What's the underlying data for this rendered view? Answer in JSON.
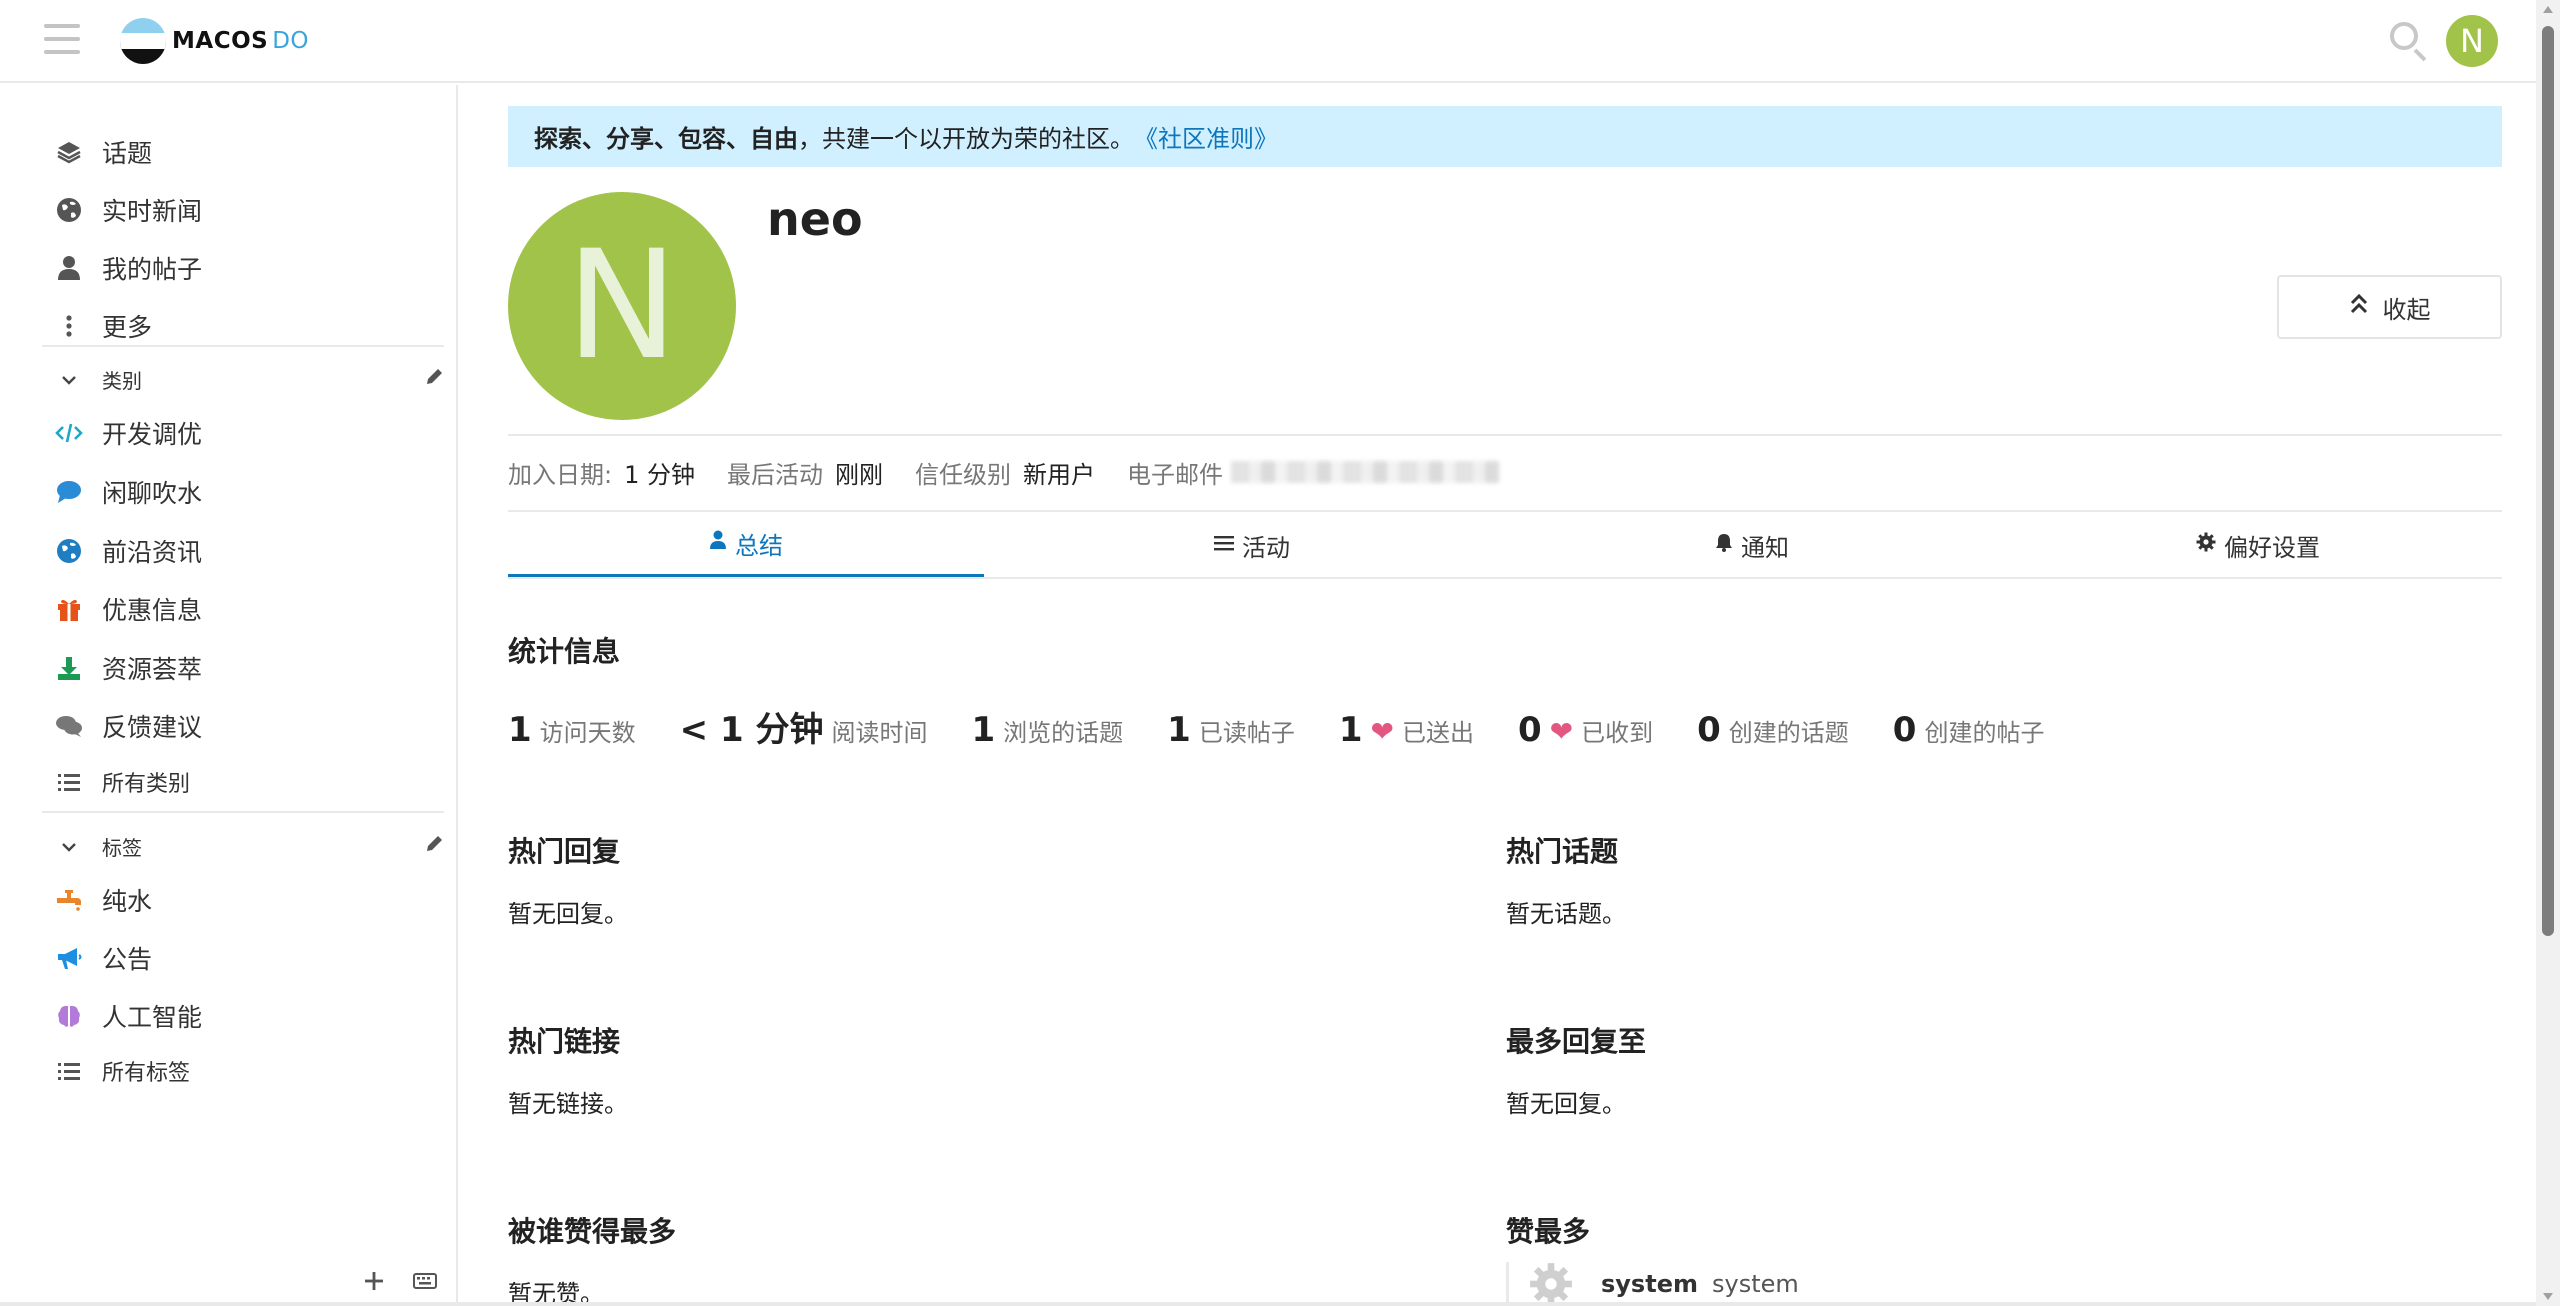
{
  "header": {
    "logo_brand": "MACOS",
    "logo_suffix": "DO",
    "avatar_letter": "N"
  },
  "sidebar": {
    "main_items": [
      {
        "label": "话题",
        "icon": "layers-icon"
      },
      {
        "label": "实时新闻",
        "icon": "globe-icon"
      },
      {
        "label": "我的帖子",
        "icon": "user-icon"
      },
      {
        "label": "更多",
        "icon": "vertical-dots-icon"
      }
    ],
    "categories_title": "类别",
    "categories": [
      {
        "label": "开发调优",
        "icon": "code-icon",
        "color": "#1ea7c9"
      },
      {
        "label": "闲聊吹水",
        "icon": "chat-bubble-icon",
        "color": "#2a8bd6"
      },
      {
        "label": "前沿资讯",
        "icon": "globe-icon",
        "color": "#1f7ec2"
      },
      {
        "label": "优惠信息",
        "icon": "gift-icon",
        "color": "#e5531a"
      },
      {
        "label": "资源荟萃",
        "icon": "download-icon",
        "color": "#1c9a53"
      },
      {
        "label": "反馈建议",
        "icon": "comments-icon",
        "color": "#777777"
      }
    ],
    "all_categories": "所有类别",
    "tags_title": "标签",
    "tags": [
      {
        "label": "纯水",
        "icon": "faucet-icon",
        "color": "#e7862d"
      },
      {
        "label": "公告",
        "icon": "megaphone-icon",
        "color": "#1c8fe0"
      },
      {
        "label": "人工智能",
        "icon": "brain-icon",
        "color": "#b27ad9"
      }
    ],
    "all_tags": "所有标签"
  },
  "banner": {
    "bold_text": "探索、分享、包容、自由",
    "text": "，共建一个以开放为荣的社区。",
    "link_text": "《社区准则》"
  },
  "profile": {
    "avatar_letter": "N",
    "username": "neo",
    "collapse_label": "收起",
    "meta": {
      "join_label": "加入日期:",
      "join_value": "1 分钟",
      "last_label": "最后活动",
      "last_value": "刚刚",
      "trust_label": "信任级别",
      "trust_value": "新用户",
      "email_label": "电子邮件"
    }
  },
  "tabs": [
    {
      "label": "总结",
      "icon": "user-icon",
      "active": true
    },
    {
      "label": "活动",
      "icon": "list-icon",
      "active": false
    },
    {
      "label": "通知",
      "icon": "bell-icon",
      "active": false
    },
    {
      "label": "偏好设置",
      "icon": "gear-icon",
      "active": false
    }
  ],
  "stats_title": "统计信息",
  "stats": [
    {
      "value": "1",
      "label": "访问天数"
    },
    {
      "value": "< 1 分钟",
      "label": "阅读时间"
    },
    {
      "value": "1",
      "label": "浏览的话题"
    },
    {
      "value": "1",
      "label": "已读帖子"
    },
    {
      "value": "1",
      "label": "已送出",
      "heart": true
    },
    {
      "value": "0",
      "label": "已收到",
      "heart": true
    },
    {
      "value": "0",
      "label": "创建的话题"
    },
    {
      "value": "0",
      "label": "创建的帖子"
    }
  ],
  "sections": {
    "top_replies": {
      "title": "热门回复",
      "empty": "暂无回复。"
    },
    "top_topics": {
      "title": "热门话题",
      "empty": "暂无话题。"
    },
    "top_links": {
      "title": "热门链接",
      "empty": "暂无链接。"
    },
    "most_replied_to": {
      "title": "最多回复至",
      "empty": "暂无回复。"
    },
    "most_liked_by": {
      "title": "被谁赞得最多",
      "empty": "暂无赞。"
    },
    "most_liked": {
      "title": "赞最多",
      "user_name": "system",
      "user_username": "system"
    }
  },
  "colors": {
    "accent": "#0e76bd",
    "avatar": "#a1c34a",
    "banner_bg": "#d1f0ff",
    "heart": "#e45682"
  }
}
